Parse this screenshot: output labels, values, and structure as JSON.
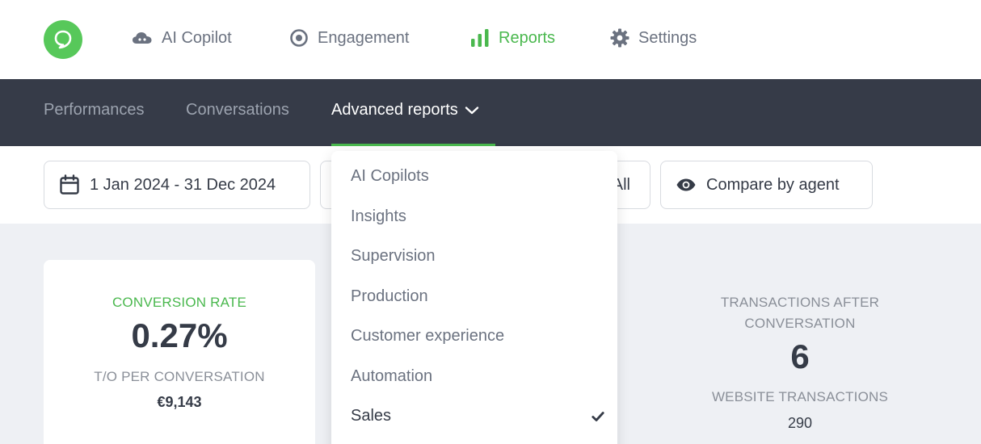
{
  "top_nav": {
    "items": [
      {
        "label": "AI Copilot",
        "icon": "cloud-icon"
      },
      {
        "label": "Engagement",
        "icon": "target-icon"
      },
      {
        "label": "Reports",
        "icon": "bar-chart-icon",
        "active": true
      },
      {
        "label": "Settings",
        "icon": "gear-icon"
      }
    ]
  },
  "sub_nav": {
    "items": [
      {
        "label": "Performances"
      },
      {
        "label": "Conversations"
      },
      {
        "label": "Advanced reports",
        "active": true
      }
    ]
  },
  "filters": {
    "date_range": "1 Jan 2024 - 31 Dec 2024",
    "hidden_filter_value": "All",
    "compare": "Compare by agent"
  },
  "dropdown": {
    "items": [
      {
        "label": "AI Copilots"
      },
      {
        "label": "Insights"
      },
      {
        "label": "Supervision"
      },
      {
        "label": "Production"
      },
      {
        "label": "Customer experience"
      },
      {
        "label": "Automation"
      },
      {
        "label": "Sales",
        "selected": true
      }
    ]
  },
  "metrics": {
    "conversion": {
      "label": "CONVERSION RATE",
      "value": "0.27%",
      "sub_label": "T/O PER CONVERSATION",
      "sub_value": "€9,143"
    },
    "transactions": {
      "label_line1": "TRANSACTIONS AFTER",
      "label_line2": "CONVERSATION",
      "value": "6",
      "sub_label": "WEBSITE TRANSACTIONS",
      "sub_value": "290"
    }
  },
  "colors": {
    "accent_green": "#4ab84e",
    "subnav_bg": "#363b48",
    "page_bg": "#eef0f4"
  }
}
